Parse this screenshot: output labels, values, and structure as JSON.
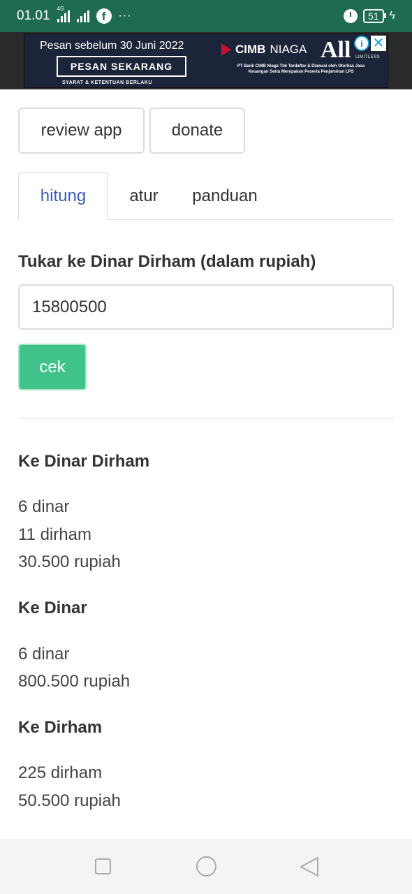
{
  "status_bar": {
    "time": "01.01",
    "network": "4G",
    "battery": "51"
  },
  "ad": {
    "headline": "Pesan sebelum 30 Juni 2022",
    "cta": "PESAN SEKARANG",
    "terms": "SYARAT & KETENTUAN BERLAKU",
    "brand_cimb": "CIMB",
    "brand_niaga": "NIAGA",
    "brand_all": "All",
    "brand_limitless": "LIMITLESS",
    "fine_print": "PT Bank CIMB Niaga Tbk Terdaftar & Diawasi oleh Otoritas Jasa Keuangan Serta Merupakan Peserta Penjaminan LPS"
  },
  "top_buttons": {
    "review": "review app",
    "donate": "donate"
  },
  "tabs": [
    {
      "label": "hitung",
      "active": true
    },
    {
      "label": "atur",
      "active": false
    },
    {
      "label": "panduan",
      "active": false
    }
  ],
  "form": {
    "label": "Tukar ke Dinar Dirham (dalam rupiah)",
    "value": "15800500",
    "submit": "cek"
  },
  "results": {
    "dinar_dirham": {
      "title": "Ke Dinar Dirham",
      "lines": [
        "6 dinar",
        "11 dirham",
        "30.500 rupiah"
      ]
    },
    "dinar": {
      "title": "Ke Dinar",
      "lines": [
        "6 dinar",
        "800.500 rupiah"
      ]
    },
    "dirham": {
      "title": "Ke Dirham",
      "lines": [
        "225 dirham",
        "50.500 rupiah"
      ]
    }
  },
  "icons": {
    "facebook": "facebook-icon",
    "alarm": "alarm-icon",
    "charging": "charging-icon",
    "info": "info-icon",
    "close": "close-icon",
    "nav_recent": "square-icon",
    "nav_home": "circle-icon",
    "nav_back": "triangle-back-icon"
  },
  "colors": {
    "status_bar": "#1f6b4f",
    "active_tab": "#3c5eb5",
    "cek_button": "#3fc38a"
  }
}
